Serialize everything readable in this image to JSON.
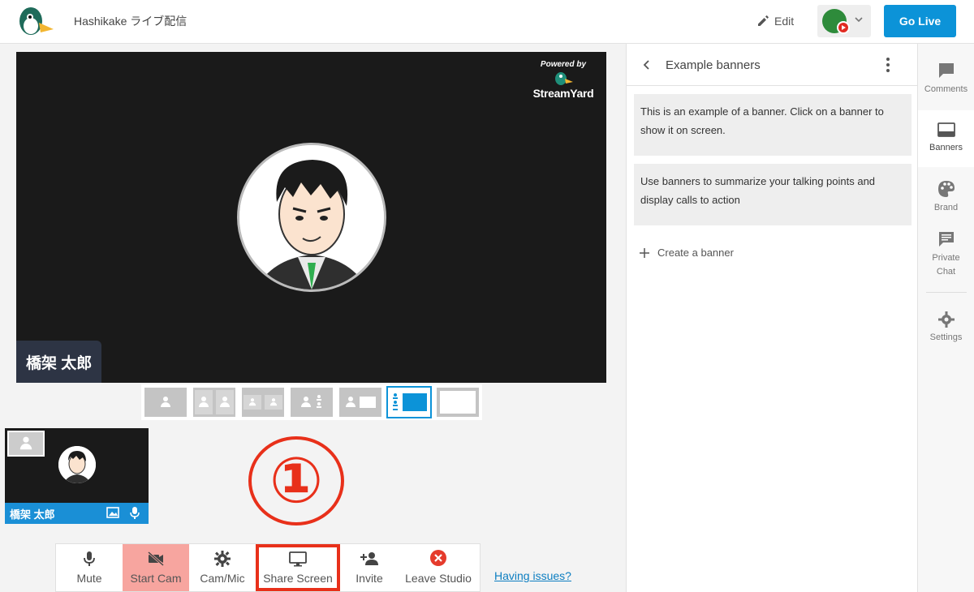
{
  "header": {
    "studio_title": "Hashikake ライブ配信",
    "edit_label": "Edit",
    "go_live_label": "Go Live"
  },
  "stage": {
    "powered_by": "Powered by",
    "brand_name": "StreamYard",
    "name_tag": "橋架 太郎"
  },
  "guest": {
    "name": "橋架 太郎"
  },
  "annotation": {
    "marker": "①"
  },
  "toolbar": {
    "mute": "Mute",
    "start_cam": "Start Cam",
    "cam_mic": "Cam/Mic",
    "share_screen": "Share Screen",
    "invite": "Invite",
    "leave_studio": "Leave Studio",
    "having_issues": "Having issues?"
  },
  "panel": {
    "title": "Example banners",
    "banners": [
      "This is an example of a banner. Click on a banner to show it on screen.",
      "Use banners to summarize your talking points and display calls to action"
    ],
    "create_banner": "Create a banner"
  },
  "sidetabs": {
    "comments": "Comments",
    "banners": "Banners",
    "brand": "Brand",
    "private_chat_1": "Private",
    "private_chat_2": "Chat",
    "settings": "Settings"
  },
  "colors": {
    "accent": "#0c93d8",
    "annotation_red": "#e8301a",
    "cam_off": "#f7a59f",
    "stage_bg": "#1a1a1a",
    "name_tag_bg": "#2d3444"
  },
  "icons": [
    "duck-logo-icon",
    "pencil-icon",
    "chevron-down-icon",
    "mic-icon",
    "camera-off-icon",
    "gear-icon",
    "monitor-icon",
    "add-person-icon",
    "close-circle-icon",
    "chevron-left-icon",
    "kebab-icon",
    "plus-icon",
    "comment-icon",
    "banner-icon",
    "palette-icon",
    "chat-icon",
    "image-icon",
    "person-icon"
  ]
}
